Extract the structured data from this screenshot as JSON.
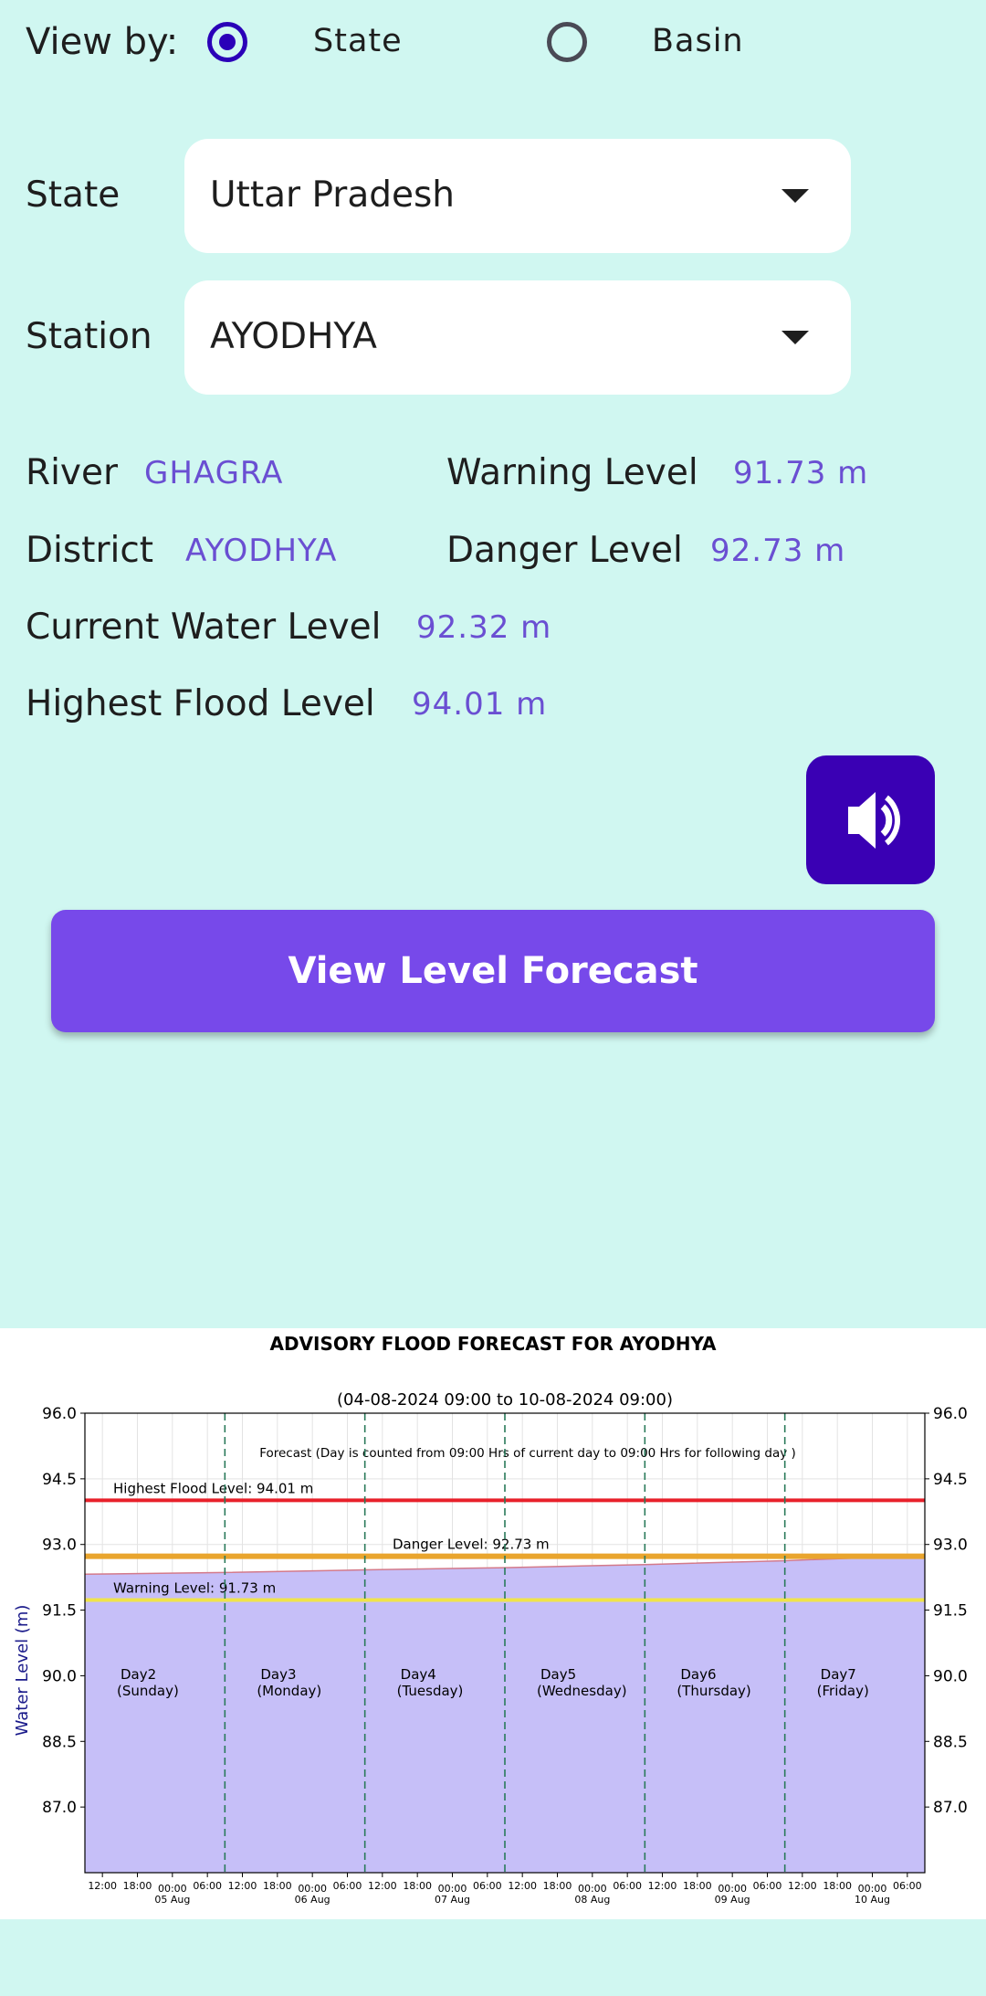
{
  "view_by": {
    "label": "View by:",
    "options": [
      {
        "label": "State",
        "selected": true
      },
      {
        "label": "Basin",
        "selected": false
      }
    ]
  },
  "state_field": {
    "label": "State",
    "value": "Uttar Pradesh"
  },
  "station_field": {
    "label": "Station",
    "value": "AYODHYA"
  },
  "info": {
    "river_label": "River",
    "river_value": "GHAGRA",
    "warning_label": "Warning Level",
    "warning_value": "91.73 m",
    "district_label": "District",
    "district_value": "AYODHYA",
    "danger_label": "Danger Level",
    "danger_value": "92.73 m",
    "current_label": "Current Water Level",
    "current_value": "92.32 m",
    "highest_label": "Highest Flood Level",
    "highest_value": "94.01 m"
  },
  "buttons": {
    "speaker_icon": "speaker-icon",
    "forecast_label": "View Level Forecast"
  },
  "colors": {
    "background": "#d0f7f1",
    "accent_value": "#6a4fd2",
    "radio": "#2a00b8",
    "speaker_button": "#3a00b4",
    "forecast_button": "#7749ea"
  },
  "chart_data": {
    "type": "area",
    "title": "ADVISORY FLOOD FORECAST FOR AYODHYA",
    "subtitle": "(04-08-2024 09:00 to 10-08-2024 09:00)",
    "note": "Forecast (Day is counted from 09:00 Hrs of current day to 09:00 Hrs for following day )",
    "ylabel": "Water Level (m)",
    "ylim": [
      85.5,
      96.0
    ],
    "xlim": [
      "2024-08-04 09:00",
      "2024-08-10 09:00"
    ],
    "yticks": [
      87.0,
      88.5,
      90.0,
      91.5,
      93.0,
      94.5,
      96.0
    ],
    "ytick_labels": [
      "87.0",
      "88.5",
      "90.0",
      "91.5",
      "93.0",
      "94.5",
      "96.0"
    ],
    "grid": true,
    "series": [
      {
        "x": [
          "2024-08-04 09:00",
          "2024-08-05 09:00",
          "2024-08-06 09:00",
          "2024-08-07 09:00",
          "2024-08-08 09:00",
          "2024-08-09 09:00",
          "2024-08-10 09:00"
        ],
        "values": [
          92.32,
          92.36,
          92.42,
          92.47,
          92.54,
          92.63,
          92.75
        ],
        "color": "#c6bff8"
      }
    ],
    "levels": [
      {
        "label": "Highest Flood Level: 94.01 m",
        "value": 94.01,
        "color": "#e8202a"
      },
      {
        "label": "Danger Level: 92.73 m",
        "value": 92.73,
        "color": "#e9a52e"
      },
      {
        "label": "Warning Level: 91.73 m",
        "value": 91.73,
        "color": "#f0e44a"
      }
    ],
    "day_boundaries": [
      "2024-08-05 09:00",
      "2024-08-06 09:00",
      "2024-08-07 09:00",
      "2024-08-08 09:00",
      "2024-08-09 09:00"
    ],
    "day_labels": [
      {
        "line1": "Day2",
        "line2": "(Sunday)"
      },
      {
        "line1": "Day3",
        "line2": "(Monday)"
      },
      {
        "line1": "Day4",
        "line2": "(Tuesday)"
      },
      {
        "line1": "Day5",
        "line2": "(Wednesday)"
      },
      {
        "line1": "Day6",
        "line2": "(Thursday)"
      },
      {
        "line1": "Day7",
        "line2": "(Friday)"
      }
    ],
    "x_hour_ticks": [
      "12:00",
      "18:00",
      "00:00",
      "06:00"
    ],
    "x_date_labels": [
      "05 Aug",
      "06 Aug",
      "07 Aug",
      "08 Aug",
      "09 Aug",
      "10 Aug"
    ]
  }
}
